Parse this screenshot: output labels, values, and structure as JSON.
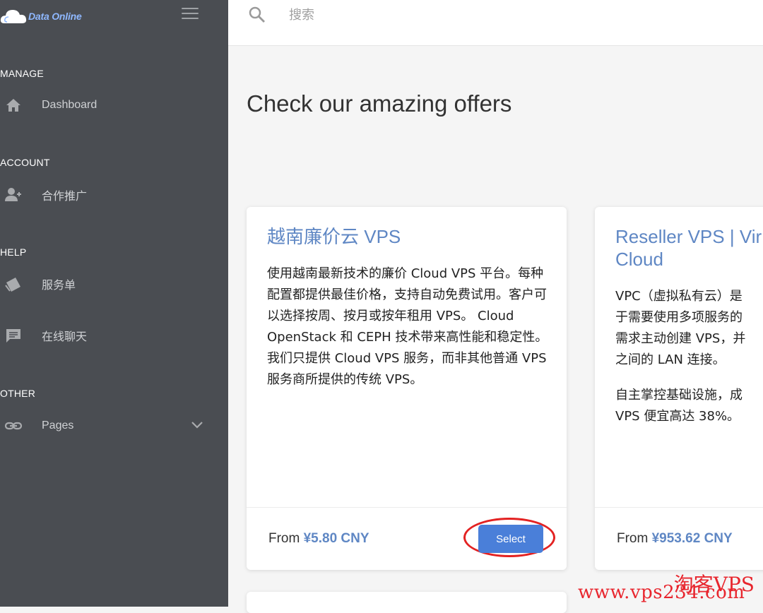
{
  "sidebar": {
    "logo_text": "Data Online",
    "sections": {
      "manage": "MANAGE",
      "account": "ACCOUNT",
      "help": "HELP",
      "other": "OTHER"
    },
    "items": {
      "dashboard": "Dashboard",
      "affiliate": "合作推广",
      "tickets": "服务单",
      "chat": "在线聊天",
      "pages": "Pages"
    }
  },
  "topbar": {
    "search_placeholder": "搜索"
  },
  "main": {
    "title": "Check our amazing offers",
    "offers": [
      {
        "title": "越南廉价云 VPS",
        "description": "使用越南最新技术的廉价 Cloud VPS 平台。每种配置都提供最佳价格，支持自动免费试用。客户可以选择按周、按月或按年租用 VPS。 Cloud OpenStack 和 CEPH 技术带来高性能和稳定性。我们只提供 Cloud VPS 服务，而非其他普通 VPS 服务商所提供的传统 VPS。",
        "price_prefix": "From",
        "price": "¥5.80 CNY",
        "button": "Select"
      },
      {
        "title_line1": "Reseller VPS | Vir",
        "title_line2": "Cloud",
        "desc_lines": [
          "VPC（虚拟私有云）是",
          "于需要使用多项服务的",
          "需求主动创建 VPS，并",
          "之间的 LAN 连接。"
        ],
        "desc2_lines": [
          "自主掌控基础设施，成",
          "VPS 便宜高达 38%。"
        ],
        "price_prefix": "From",
        "price": "¥953.62 CNY"
      }
    ]
  },
  "watermark": {
    "line1": "淘客VPS",
    "line2": "www.vps234.com"
  },
  "colors": {
    "sidebar_bg": "#4a4d52",
    "accent": "#5f87c4",
    "button": "#4a7fd9",
    "highlight_ring": "#e32222"
  }
}
